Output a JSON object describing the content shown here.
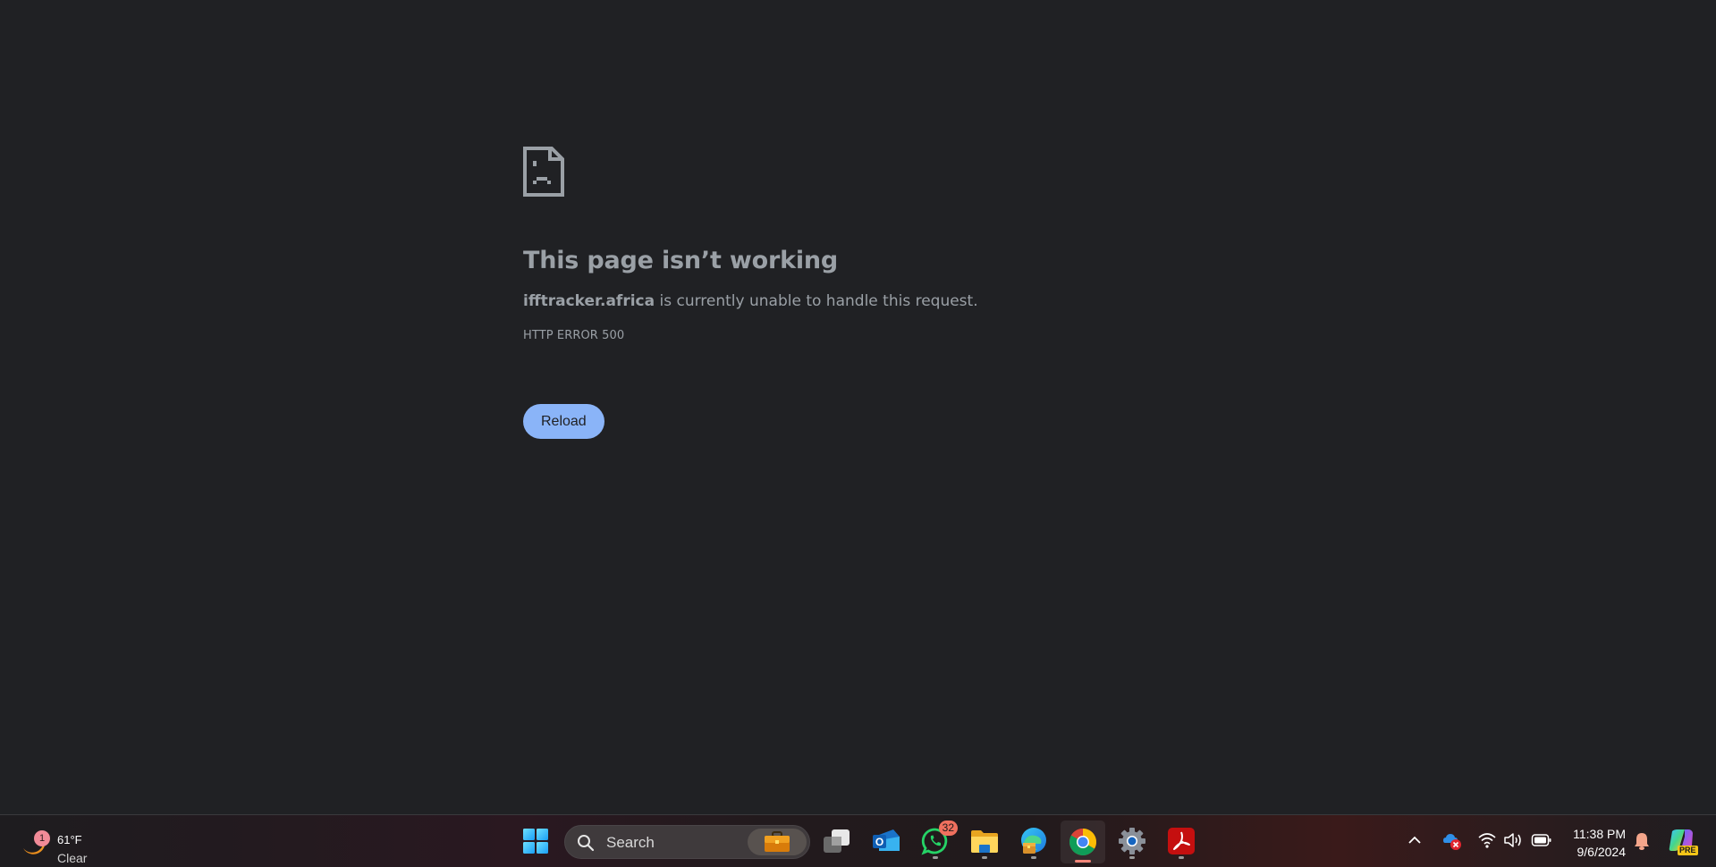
{
  "page": {
    "title": "This page isn’t working",
    "domain": "ifftracker.africa",
    "description_suffix": " is currently unable to handle this request.",
    "error_code": "HTTP ERROR 500",
    "reload_label": "Reload",
    "icon": "sad-page-icon"
  },
  "taskbar": {
    "weather": {
      "badge_count": "1",
      "temperature": "61°F",
      "condition": "Clear",
      "icon": "moon-icon"
    },
    "start_icon": "windows-start-icon",
    "search": {
      "placeholder": "Search",
      "icon": "search-icon",
      "decoration_icon": "briefcase-icon"
    },
    "apps": [
      {
        "name": "Task View",
        "icon": "task-view-icon",
        "running": false
      },
      {
        "name": "Outlook",
        "icon": "outlook-icon",
        "running": false
      },
      {
        "name": "WhatsApp",
        "icon": "whatsapp-icon",
        "running": true,
        "badge": "32"
      },
      {
        "name": "File Explorer",
        "icon": "folder-icon",
        "running": true
      },
      {
        "name": "Microsoft Edge",
        "icon": "edge-icon",
        "running": true
      },
      {
        "name": "Google Chrome",
        "icon": "chrome-icon",
        "running": true,
        "active": true
      },
      {
        "name": "Settings",
        "icon": "settings-gear-icon",
        "running": true
      },
      {
        "name": "Adobe Acrobat",
        "icon": "acrobat-icon",
        "running": true
      }
    ],
    "tray": {
      "overflow_icon": "chevron-up-icon",
      "onedrive_icon": "onedrive-error-icon",
      "wifi_icon": "wifi-icon",
      "volume_icon": "speaker-icon",
      "battery_icon": "battery-icon",
      "time": "11:38 PM",
      "date": "9/6/2024",
      "notification_icon": "bell-icon",
      "copilot_icon": "copilot-icon",
      "copilot_badge": "PRE"
    }
  },
  "colors": {
    "page_bg": "#202124",
    "text": "#9aa0a6",
    "button_bg": "#8ab4f8",
    "active_indicator": "#f4877a"
  }
}
